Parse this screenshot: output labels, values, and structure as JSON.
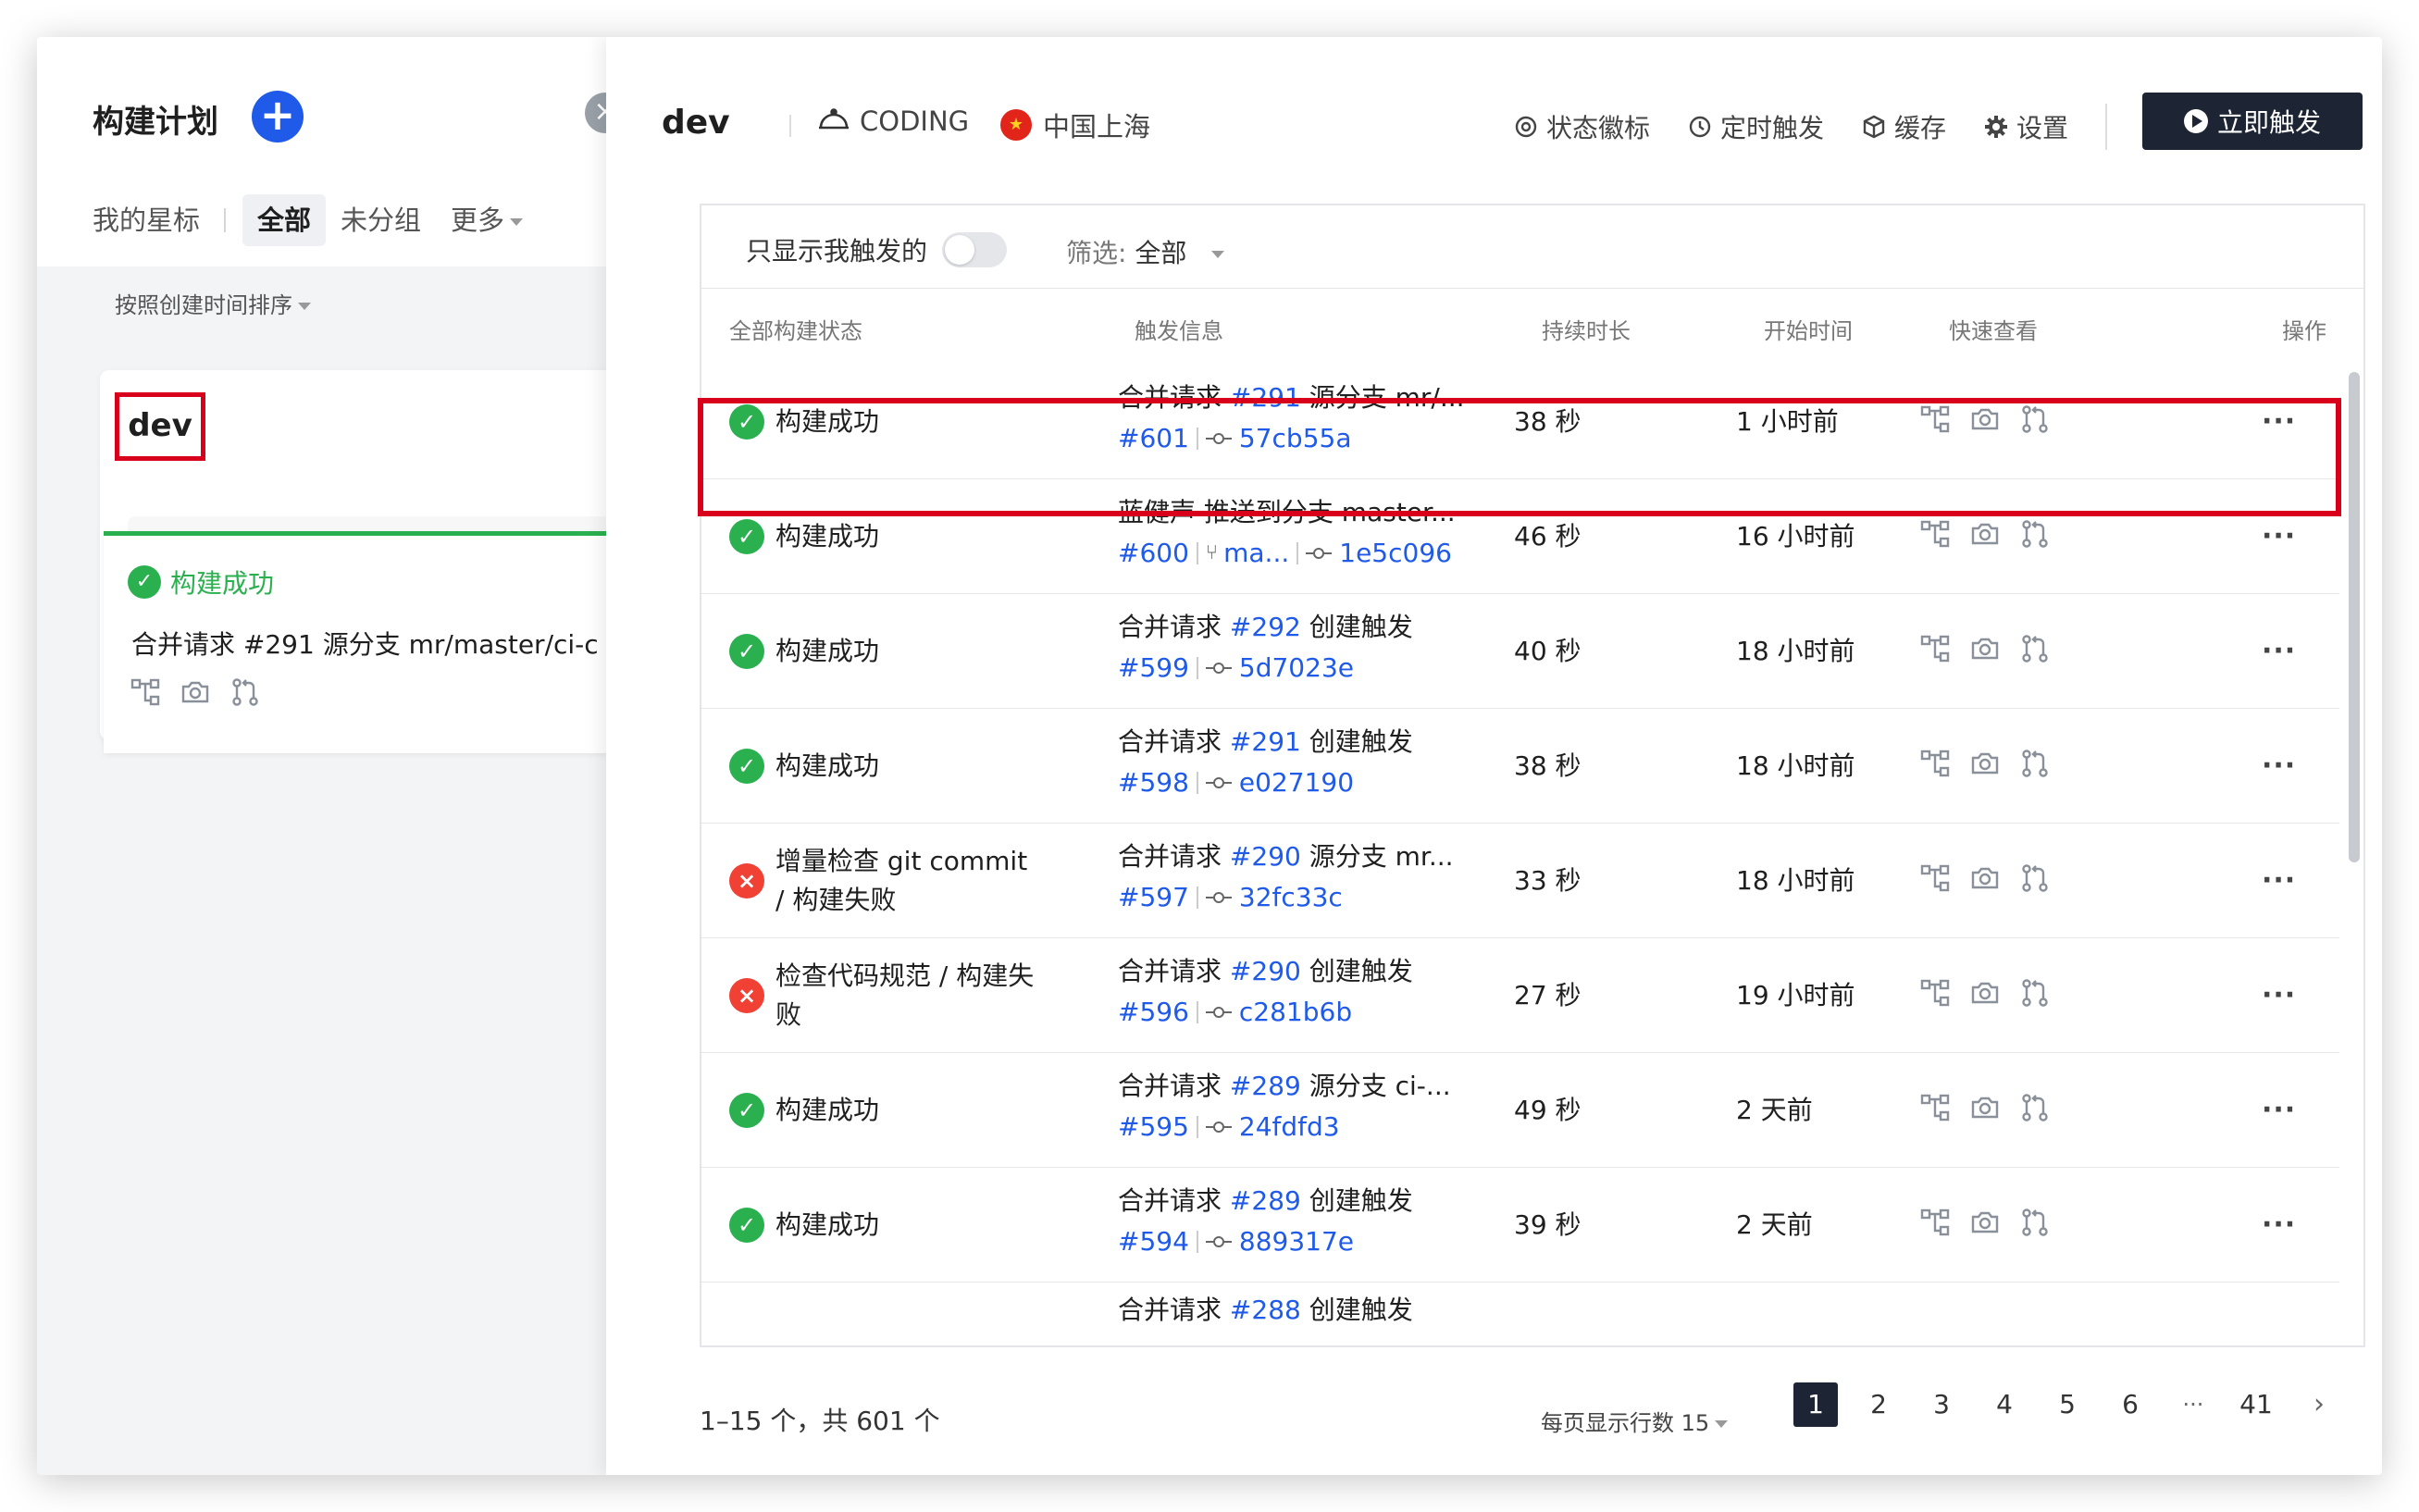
{
  "left": {
    "title": "构建计划",
    "tabs": [
      "我的星标",
      "全部",
      "未分组",
      "更多"
    ],
    "sort_label": "按照创建时间排序",
    "card": {
      "name": "dev",
      "status": "构建成功",
      "summary": "合并请求 #291 源分支 mr/master/ci-c"
    }
  },
  "right": {
    "name": "dev",
    "repo": "CODING",
    "region": "中国上海",
    "tools": [
      "状态徽标",
      "定时触发",
      "缓存",
      "设置"
    ],
    "trigger_button": "立即触发",
    "filter": {
      "mine_only_label": "只显示我触发的",
      "filter_label": "筛选:",
      "filter_value": "全部"
    },
    "columns": [
      "全部构建状态",
      "触发信息",
      "持续时长",
      "开始时间",
      "快速查看",
      "操作"
    ],
    "rows": [
      {
        "status": "构建成功",
        "ok": true,
        "t_pre": "合并请求",
        "t_ref": "#291",
        "t_post": "源分支 mr/...",
        "build": "#601",
        "branch": "",
        "commit": "57cb55a",
        "duration": "38 秒",
        "start": "1 小时前"
      },
      {
        "status": "构建成功",
        "ok": true,
        "t_pre": "蓝健声 推送到分支 master...",
        "t_ref": "",
        "t_post": "",
        "build": "#600",
        "branch": "ma...",
        "commit": "1e5c096",
        "duration": "46 秒",
        "start": "16 小时前"
      },
      {
        "status": "构建成功",
        "ok": true,
        "t_pre": "合并请求",
        "t_ref": "#292",
        "t_post": "创建触发",
        "build": "#599",
        "branch": "",
        "commit": "5d7023e",
        "duration": "40 秒",
        "start": "18 小时前"
      },
      {
        "status": "构建成功",
        "ok": true,
        "t_pre": "合并请求",
        "t_ref": "#291",
        "t_post": "创建触发",
        "build": "#598",
        "branch": "",
        "commit": "e027190",
        "duration": "38 秒",
        "start": "18 小时前"
      },
      {
        "status": "增量检查 git commit / 构建失败",
        "ok": false,
        "t_pre": "合并请求",
        "t_ref": "#290",
        "t_post": "源分支 mr...",
        "build": "#597",
        "branch": "",
        "commit": "32fc33c",
        "duration": "33 秒",
        "start": "18 小时前"
      },
      {
        "status": "检查代码规范 / 构建失败",
        "ok": false,
        "t_pre": "合并请求",
        "t_ref": "#290",
        "t_post": "创建触发",
        "build": "#596",
        "branch": "",
        "commit": "c281b6b",
        "duration": "27 秒",
        "start": "19 小时前"
      },
      {
        "status": "构建成功",
        "ok": true,
        "t_pre": "合并请求",
        "t_ref": "#289",
        "t_post": "源分支 ci-...",
        "build": "#595",
        "branch": "",
        "commit": "24fdfd3",
        "duration": "49 秒",
        "start": "2 天前"
      },
      {
        "status": "构建成功",
        "ok": true,
        "t_pre": "合并请求",
        "t_ref": "#289",
        "t_post": "创建触发",
        "build": "#594",
        "branch": "",
        "commit": "889317e",
        "duration": "39 秒",
        "start": "2 天前"
      }
    ],
    "partial_row": {
      "t_pre": "合并请求",
      "t_ref": "#288",
      "t_post": "创建触发"
    },
    "pagination": {
      "info": "1–15 个，共 601 个",
      "per_page": "每页显示行数 15",
      "pages": [
        "1",
        "2",
        "3",
        "4",
        "5",
        "6",
        "···",
        "41"
      ],
      "current": "1"
    }
  },
  "icons": {
    "status_ok": "check-circle-icon",
    "status_fail": "x-circle-icon",
    "quick": [
      "pipeline-icon",
      "camera-icon",
      "merge-request-icon"
    ]
  },
  "colors": {
    "primary": "#1f5ae8",
    "success": "#2bb04f",
    "error": "#f04134",
    "highlight": "#d9001b",
    "dark_button": "#1d2433"
  }
}
